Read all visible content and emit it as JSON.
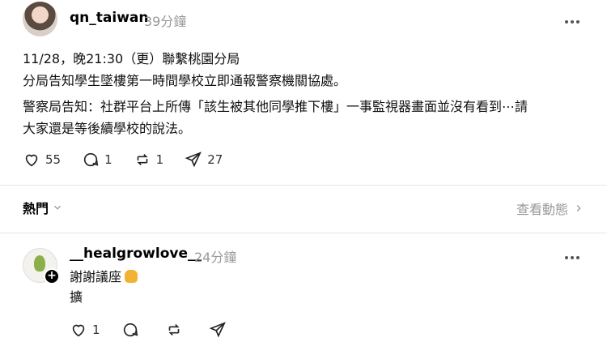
{
  "post": {
    "username": "qn_taiwan",
    "time": "39分鐘",
    "line1": "11/28，晚21:30（更）聯繫桃園分局",
    "line2": "分局告知學生墜樓第一時間學校立即通報警察機關協處。",
    "line3": "警察局告知：社群平台上所傳「該生被其他同學推下樓」一事監視器畫面並沒有看到⋯請",
    "line4": "大家還是等後續學校的說法。",
    "likes": "55",
    "comments": "1",
    "reposts": "1",
    "shares": "27"
  },
  "sort": {
    "label": "熱門",
    "activity_label": "查看動態"
  },
  "reply": {
    "username": "__healgrowlove__",
    "time": "24分鐘",
    "line1": "謝謝議座",
    "line2": "擴",
    "likes": "1"
  },
  "icons": {
    "like": "heart-icon",
    "comment": "comment-icon",
    "repost": "repost-icon",
    "share": "send-icon",
    "more": "more-icon",
    "chevron_down": "chevron-down-icon",
    "chevron_right": "chevron-right-icon",
    "emoji": "folded-hands-emoji"
  }
}
